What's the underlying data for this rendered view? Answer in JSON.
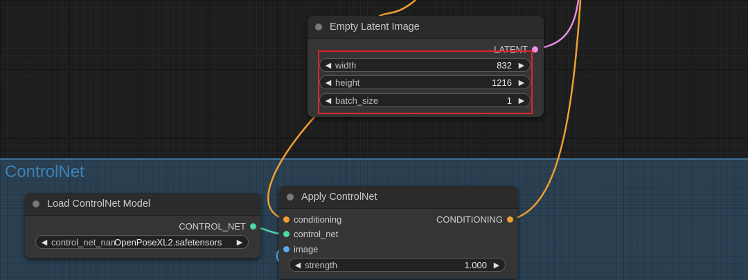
{
  "group": {
    "title": "ControlNet"
  },
  "empty_latent": {
    "title": "Empty Latent Image",
    "output": "LATENT",
    "widgets": [
      {
        "label": "width",
        "value": "832"
      },
      {
        "label": "height",
        "value": "1216"
      },
      {
        "label": "batch_size",
        "value": "1"
      }
    ]
  },
  "load_controlnet": {
    "title": "Load ControlNet Model",
    "output": "CONTROL_NET",
    "widget": {
      "label": "control_net_nam",
      "value": "OpenPoseXL2.safetensors"
    }
  },
  "apply_controlnet": {
    "title": "Apply ControlNet",
    "inputs": [
      "conditioning",
      "control_net",
      "image"
    ],
    "output": "CONDITIONING",
    "widget": {
      "label": "strength",
      "value": "1.000"
    }
  },
  "colors": {
    "conditioning": "#f0a030",
    "control_net": "#4cd8a8",
    "image": "#5aa8f0",
    "latent": "#f08ee8",
    "highlight": "#e0242a"
  }
}
